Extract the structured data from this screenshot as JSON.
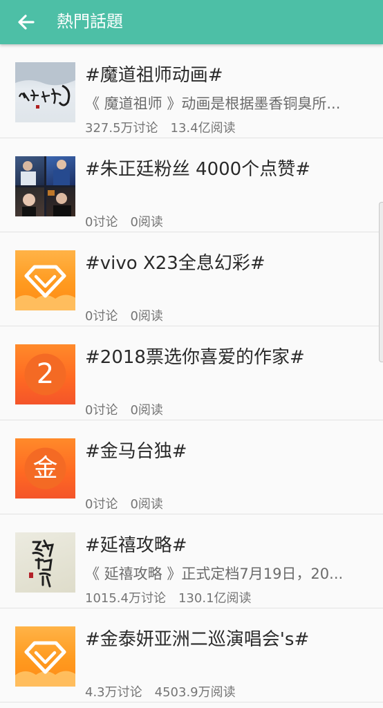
{
  "header": {
    "title": "熱門話題",
    "back_icon": "arrow-left-icon",
    "background": "#4dbfa6"
  },
  "topics": [
    {
      "title": "#魔道祖师动画#",
      "description": "《 魔道祖师 》动画是根据墨香铜臭所...",
      "discuss": "327.5万讨论",
      "read": "13.4亿阅读",
      "thumbnail": "ink-calligraphy-image"
    },
    {
      "title": "#朱正廷粉丝 4000个点赞#",
      "description": "",
      "discuss": "0讨论",
      "read": "0阅读",
      "thumbnail": "photo-collage"
    },
    {
      "title": "#vivo X23全息幻彩#",
      "description": "",
      "discuss": "0讨论",
      "read": "0阅读",
      "thumbnail": "diamond-icon"
    },
    {
      "title": "#2018票选你喜爱的作家#",
      "description": "",
      "discuss": "0讨论",
      "read": "0阅读",
      "thumbnail": "number-badge",
      "thumbnail_text": "2"
    },
    {
      "title": "#金马台独#",
      "description": "",
      "discuss": "0讨论",
      "read": "0阅读",
      "thumbnail": "character-badge",
      "thumbnail_text": "金"
    },
    {
      "title": "#延禧攻略#",
      "description": "《 延禧攻略 》正式定档7月19日，20...",
      "discuss": "1015.4万讨论",
      "read": "130.1亿阅读",
      "thumbnail": "calligraphy-title-image"
    },
    {
      "title": "#金泰妍亚洲二巡演唱会's#",
      "description": "",
      "discuss": "4.3万讨论",
      "read": "4503.9万阅读",
      "thumbnail": "diamond-icon"
    }
  ]
}
